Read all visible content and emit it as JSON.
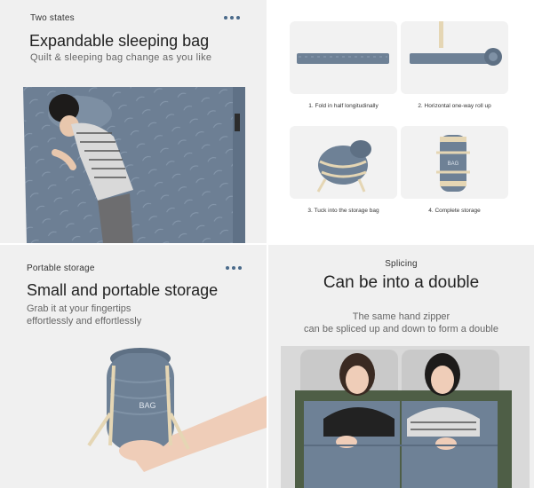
{
  "panels": {
    "two_states": {
      "tag": "Two states",
      "title": "Expandable sleeping bag",
      "subtitle": "Quilt & sleeping bag change as you like"
    },
    "steps": [
      {
        "caption": "1. Fold in half longitudinally"
      },
      {
        "caption": "2. Horizontal one-way roll up"
      },
      {
        "caption": "3. Tuck into the storage bag"
      },
      {
        "caption": "4. Complete storage"
      }
    ],
    "portable": {
      "tag": "Portable storage",
      "title": "Small and portable storage",
      "subtitle_line1": "Grab it at your fingertips",
      "subtitle_line2": "effortlessly and effortlessly",
      "bag_text": "BAG"
    },
    "splicing": {
      "tag": "Splicing",
      "title": "Can be into a double",
      "subtitle_line1": "The same hand zipper",
      "subtitle_line2": "can be spliced up and down to form a double"
    }
  },
  "colors": {
    "bag_blue": "#6e8196",
    "bag_dark": "#4f6173",
    "strap": "#e5d6b4",
    "accent_dots": "#4a6a8a"
  }
}
